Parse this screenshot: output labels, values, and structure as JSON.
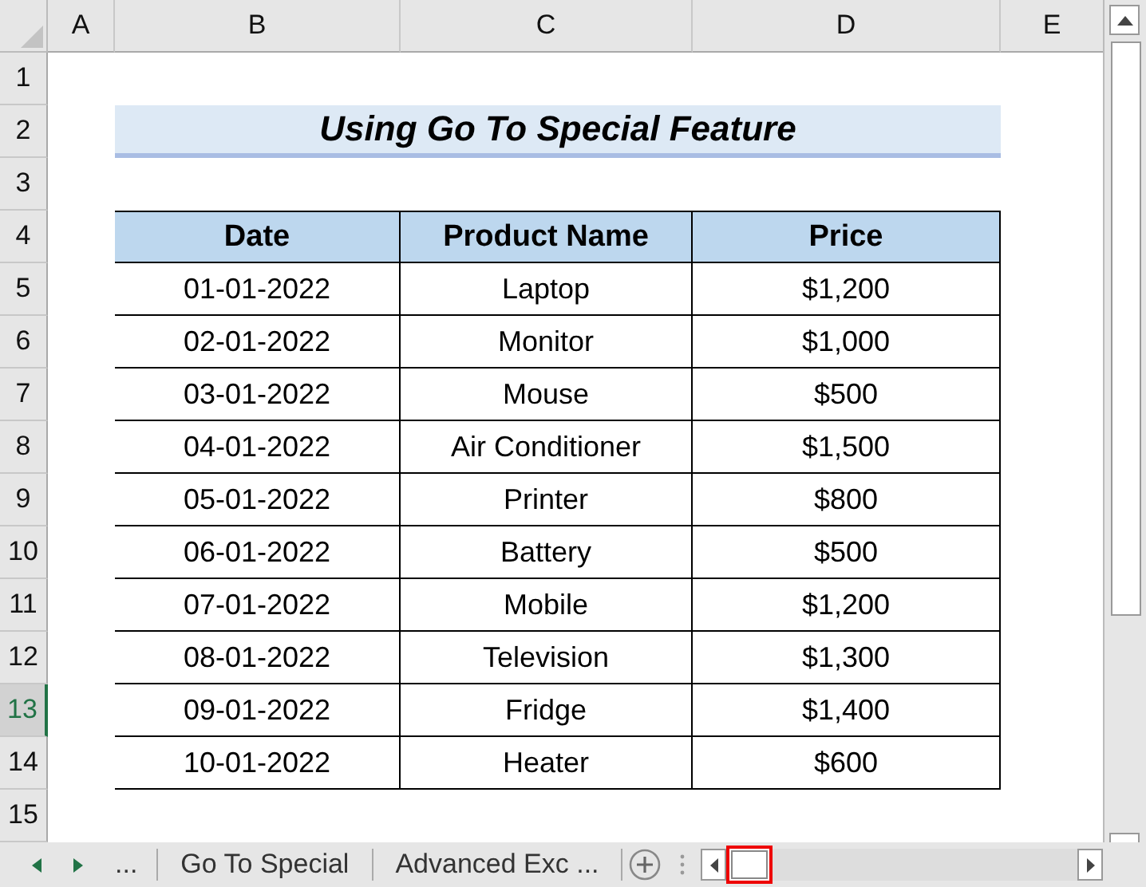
{
  "column_headers": [
    "A",
    "B",
    "C",
    "D",
    "E"
  ],
  "row_headers": [
    {
      "label": "1",
      "selected": false
    },
    {
      "label": "2",
      "selected": false
    },
    {
      "label": "3",
      "selected": false
    },
    {
      "label": "4",
      "selected": false
    },
    {
      "label": "5",
      "selected": false
    },
    {
      "label": "6",
      "selected": false
    },
    {
      "label": "7",
      "selected": false
    },
    {
      "label": "8",
      "selected": false
    },
    {
      "label": "9",
      "selected": false
    },
    {
      "label": "10",
      "selected": false
    },
    {
      "label": "11",
      "selected": false
    },
    {
      "label": "12",
      "selected": false
    },
    {
      "label": "13",
      "selected": true
    },
    {
      "label": "14",
      "selected": false
    },
    {
      "label": "15",
      "selected": false
    }
  ],
  "title": "Using Go To Special Feature",
  "table": {
    "columns": [
      "Date",
      "Product Name",
      "Price"
    ],
    "rows": [
      [
        "01-01-2022",
        "Laptop",
        "$1,200"
      ],
      [
        "02-01-2022",
        "Monitor",
        "$1,000"
      ],
      [
        "03-01-2022",
        "Mouse",
        "$500"
      ],
      [
        "04-01-2022",
        "Air Conditioner",
        "$1,500"
      ],
      [
        "05-01-2022",
        "Printer",
        "$800"
      ],
      [
        "06-01-2022",
        "Battery",
        "$500"
      ],
      [
        "07-01-2022",
        "Mobile",
        "$1,200"
      ],
      [
        "08-01-2022",
        "Television",
        "$1,300"
      ],
      [
        "09-01-2022",
        "Fridge",
        "$1,400"
      ],
      [
        "10-01-2022",
        "Heater",
        "$600"
      ]
    ]
  },
  "sheet_bar": {
    "more_tabs": "...",
    "tabs": [
      "Go To Special",
      "Advanced Exc ..."
    ]
  }
}
